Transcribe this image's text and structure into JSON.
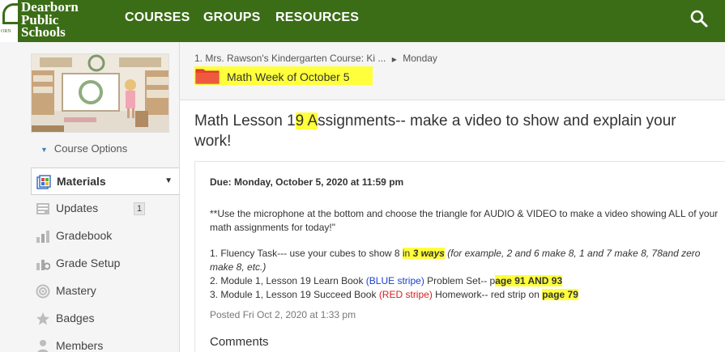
{
  "header": {
    "logo_lines": [
      "Dearborn",
      "Public",
      "Schools"
    ],
    "logo_small_text": "ORN",
    "nav": [
      "COURSES",
      "GROUPS",
      "RESOURCES"
    ]
  },
  "sidebar": {
    "course_options": "Course Options",
    "items": [
      {
        "label": "Materials",
        "icon": "materials-icon"
      },
      {
        "label": "Updates",
        "icon": "updates-icon",
        "count": "1"
      },
      {
        "label": "Gradebook",
        "icon": "gradebook-icon"
      },
      {
        "label": "Grade Setup",
        "icon": "grade-setup-icon"
      },
      {
        "label": "Mastery",
        "icon": "mastery-icon"
      },
      {
        "label": "Badges",
        "icon": "badges-icon"
      },
      {
        "label": "Members",
        "icon": "members-icon"
      }
    ]
  },
  "breadcrumb": {
    "course": "1. Mrs. Rawson's Kindergarten Course: Ki ...",
    "separator": "▶",
    "current": "Monday"
  },
  "folder": {
    "title": "Math Week of October 5",
    "color": "#e8432d"
  },
  "assignment": {
    "title_a": "Math Lesson 1",
    "title_b": "9 A",
    "title_c": "ssignments-- make a video to show and explain your work!",
    "due_label": "Due: Monday, October 5, 2020 at 11:59 pm",
    "instructions": "**Use the microphone at the bottom and choose the triangle for AUDIO & VIDEO to make a video showing ALL of your math assignments for today!\"",
    "task1_a": "1.  Fluency Task--- use your cubes to show 8 ",
    "task1_b": "in ",
    "task1_c": "3 ways",
    "task1_d": " (for example, 2 and 6 make 8, 1 and 7  make 8, 78and zero make 8, etc.)",
    "task2_a": "2.  Module 1, Lesson 19 Learn Book ",
    "task2_b": "(BLUE stripe)",
    "task2_c": " Problem Set-- p",
    "task2_d": "age 91 AND 93",
    "task3_a": "3. Module 1, Lesson 19 Succeed Book ",
    "task3_b": "(RED stripe)",
    "task3_c": " Homework-- red strip on ",
    "task3_d": "page 79",
    "posted": "Posted Fri Oct 2, 2020 at 1:33 pm",
    "comments": "Comments"
  },
  "colors": {
    "header_green": "#3b6d16",
    "highlight": "#ffff3b",
    "link_blue": "#1a3fd0",
    "red": "#d52020"
  }
}
